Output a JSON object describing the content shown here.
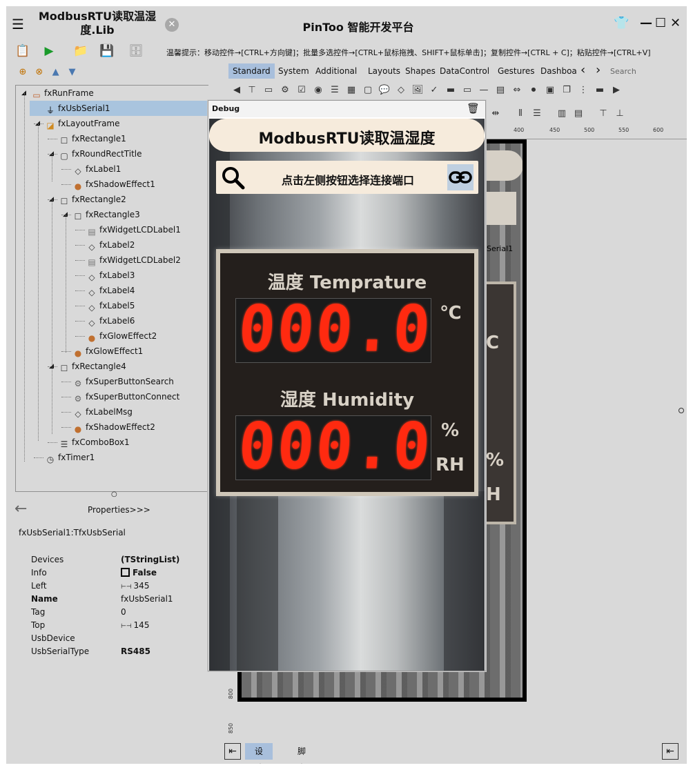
{
  "titlebar": {
    "project_title": "ModbusRTU读取温湿度.Lib",
    "app_title": "PinToo 智能开发平台"
  },
  "toolbar": {
    "hint": "温馨提示：移动控件→[CTRL+方向键]；批量多选控件→[CTRL+鼠标拖拽、SHIFT+鼠标单击]；复制控件→[CTRL + C]；粘贴控件→[CTRL+V]"
  },
  "tree": {
    "items": [
      {
        "label": "fxRunFrame",
        "icon": "frame-icon"
      },
      {
        "label": "fxUsbSerial1",
        "icon": "usb-icon"
      },
      {
        "label": "fxLayoutFrame",
        "icon": "layout-icon"
      },
      {
        "label": "fxRectangle1",
        "icon": "rectangle-icon"
      },
      {
        "label": "fxRoundRectTitle",
        "icon": "roundrect-icon"
      },
      {
        "label": "fxLabel1",
        "icon": "label-icon"
      },
      {
        "label": "fxShadowEffect1",
        "icon": "effect-icon"
      },
      {
        "label": "fxRectangle2",
        "icon": "rectangle-icon"
      },
      {
        "label": "fxRectangle3",
        "icon": "rectangle-icon"
      },
      {
        "label": "fxWidgetLCDLabel1",
        "icon": "lcd-icon"
      },
      {
        "label": "fxLabel2",
        "icon": "label-icon"
      },
      {
        "label": "fxWidgetLCDLabel2",
        "icon": "lcd-icon"
      },
      {
        "label": "fxLabel3",
        "icon": "label-icon"
      },
      {
        "label": "fxLabel4",
        "icon": "label-icon"
      },
      {
        "label": "fxLabel5",
        "icon": "label-icon"
      },
      {
        "label": "fxLabel6",
        "icon": "label-icon"
      },
      {
        "label": "fxGlowEffect2",
        "icon": "effect-icon"
      },
      {
        "label": "fxGlowEffect1",
        "icon": "effect-icon"
      },
      {
        "label": "fxRectangle4",
        "icon": "rectangle-icon"
      },
      {
        "label": "fxSuperButtonSearch",
        "icon": "button-icon"
      },
      {
        "label": "fxSuperButtonConnect",
        "icon": "button-icon"
      },
      {
        "label": "fxLabelMsg",
        "icon": "label-icon"
      },
      {
        "label": "fxShadowEffect2",
        "icon": "effect-icon"
      },
      {
        "label": "fxComboBox1",
        "icon": "combobox-icon"
      },
      {
        "label": "fxTimer1",
        "icon": "timer-icon"
      }
    ]
  },
  "properties": {
    "header": "Properties>>>",
    "object": "fxUsbSerial1:TfxUsbSerial",
    "rows": [
      {
        "key": "Devices",
        "value": "(TStringList)"
      },
      {
        "key": "Info",
        "value": "False"
      },
      {
        "key": "Left",
        "value": "345"
      },
      {
        "key": "Name",
        "value": "fxUsbSerial1"
      },
      {
        "key": "Tag",
        "value": "0"
      },
      {
        "key": "Top",
        "value": "145"
      },
      {
        "key": "UsbDevice",
        "value": ""
      },
      {
        "key": "UsbSerialType",
        "value": "RS485"
      }
    ]
  },
  "palette": {
    "tabs": [
      "Standard",
      "System",
      "Additional",
      "Layouts",
      "Shapes",
      "DataControl",
      "Gestures",
      "Dashboar"
    ],
    "search_placeholder": "Search"
  },
  "ruler": {
    "h": [
      "400",
      "450",
      "500",
      "550",
      "600"
    ],
    "v": [
      "800",
      "850"
    ]
  },
  "canvas": {
    "peek_label": "Serial1",
    "peek_c": "C",
    "peek_pct": "%",
    "peek_h": "H"
  },
  "debug": {
    "title": "Debug",
    "header": "ModbusRTU读取温湿度",
    "conn_msg": "点击左侧按钮选择连接端口",
    "temp_title": "温度 Temprature",
    "temp_value": "000.00",
    "temp_unit": "℃",
    "hum_title": "湿度 Humidity",
    "hum_value": "000.00",
    "hum_unit_1": "%",
    "hum_unit_2": "RH"
  },
  "bottom": {
    "tab_design": "设计",
    "tab_script": "脚本"
  },
  "colors": {
    "accent": "#a8bfdc",
    "lcd": "#ff2a10",
    "panel": "#241f1c",
    "pill": "#f6ebdc"
  }
}
